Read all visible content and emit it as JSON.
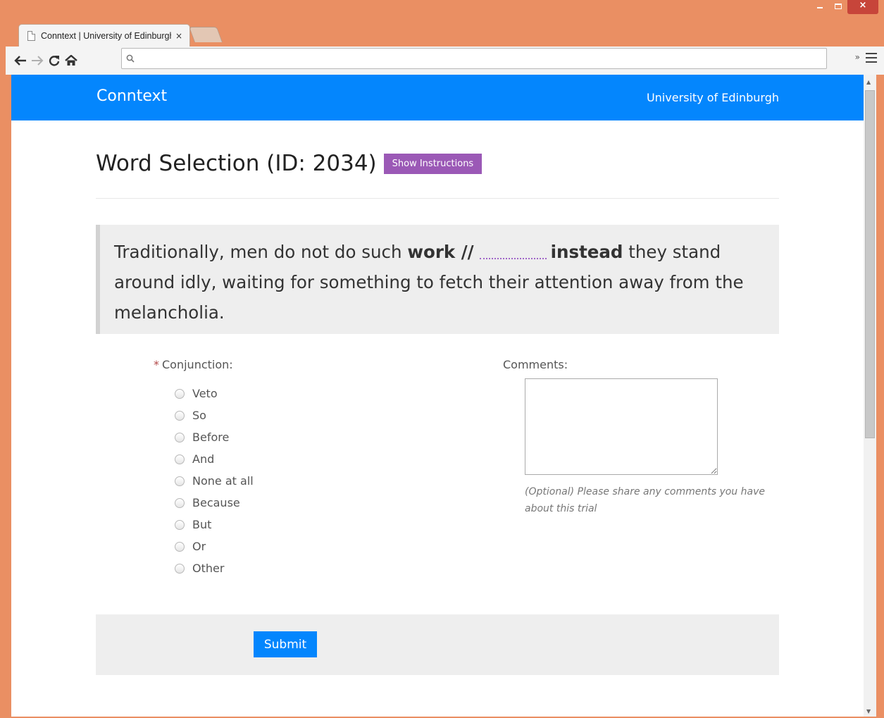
{
  "browser": {
    "tab_title": "Conntext | University of Edinburgh",
    "tab_close": "×",
    "url": "",
    "window": {
      "minimize": "",
      "maximize": "",
      "close": "×"
    },
    "extensions_label": "»"
  },
  "site": {
    "brand": "Conntext",
    "university": "University of Edinburgh"
  },
  "page": {
    "title": "Word Selection (ID: 2034)",
    "instructions_button": "Show Instructions",
    "sentence": {
      "part1": "Traditionally, men do not do such ",
      "bold1": "work //",
      "bold2": "instead",
      "part2": " they stand around idly, waiting for something to fetch their attention away from the melancholia."
    }
  },
  "form": {
    "required_marker": "*",
    "conjunction_label": "Conjunction:",
    "options": [
      "Veto",
      "So",
      "Before",
      "And",
      "None at all",
      "Because",
      "But",
      "Or",
      "Other"
    ],
    "comments_label": "Comments:",
    "comments_value": "",
    "comments_help": "(Optional) Please share any comments you have about this trial",
    "submit_label": "Submit"
  },
  "colors": {
    "navbar": "#0486fd",
    "instructions_button": "#9b59b6",
    "submit_button": "#0486fd",
    "window_frame": "#ea8f63"
  }
}
